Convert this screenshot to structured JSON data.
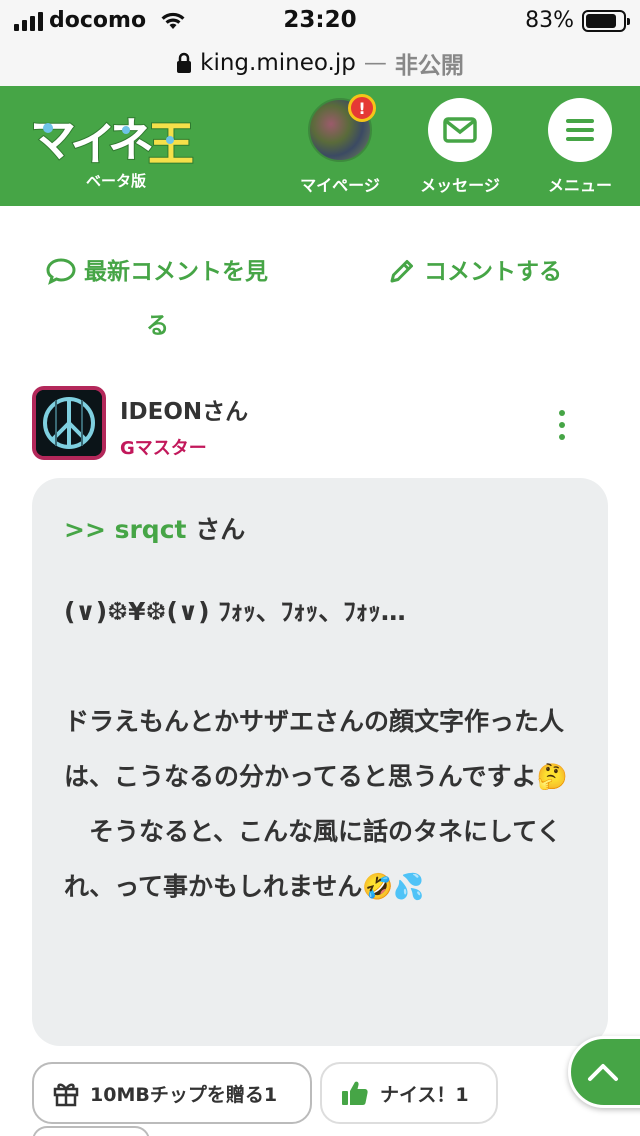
{
  "status_bar": {
    "carrier": "docomo",
    "time": "23:20",
    "battery_percent": "83%",
    "battery_level": 0.83
  },
  "browser": {
    "host": "king.mineo.jp",
    "separator": "—",
    "privacy": "非公開"
  },
  "header": {
    "logo_sub": "ベータ版",
    "nav": {
      "mypage": "マイページ",
      "messages": "メッセージ",
      "menu": "メニュー"
    },
    "badge": "!"
  },
  "actions": {
    "latest_line1": "最新コメントを見",
    "latest_line2": "る",
    "comment": "コメントする"
  },
  "comment": {
    "author": "IDEONさん",
    "rank": "Gマスター",
    "reply_prefix": ">> srqct",
    "reply_suffix": " さん",
    "body": "(∨)❆¥❆(∨) ﾌｫｯ、ﾌｫｯ、ﾌｫｯ…\n\nドラえもんとかサザエさんの顔文字作った人は、こうなるの分かってると思うんですよ🤔\n　そうなると、こんな風に話のタネにしてくれ、って事かもしれません🤣💦",
    "tip_label": "10MBチップを贈る1",
    "nice_label": "ナイス！1"
  },
  "colors": {
    "brand_green": "#46a546",
    "rank_magenta": "#c2185b"
  }
}
